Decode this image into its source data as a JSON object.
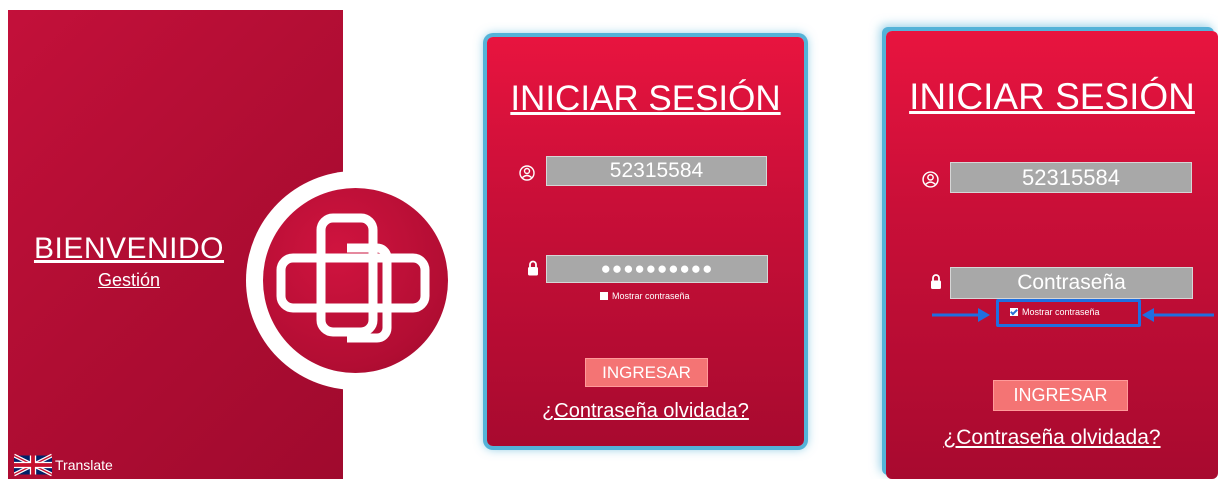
{
  "welcome": {
    "title": "BIENVENIDO",
    "subtitle": "Gestión",
    "translate_label": "Translate"
  },
  "login_default": {
    "title": "INICIAR SESIÓN",
    "username_value": "52315584",
    "password_value": "●●●●●●●●●●",
    "show_password_label": "Mostrar contraseña",
    "submit_label": "INGRESAR",
    "forgot_label": "¿Contraseña olvidada?"
  },
  "login_show": {
    "title": "INICIAR SESIÓN",
    "username_value": "52315584",
    "password_value": "Contraseña",
    "show_password_label": "Mostrar contraseña",
    "show_password_checked": true,
    "submit_label": "INGRESAR",
    "forgot_label": "¿Contraseña olvidada?"
  },
  "colors": {
    "brand_red": "#c3103a",
    "field_gray": "#a8a8a8",
    "button_pink": "#f47474",
    "highlight_blue": "#1f6fe0"
  }
}
